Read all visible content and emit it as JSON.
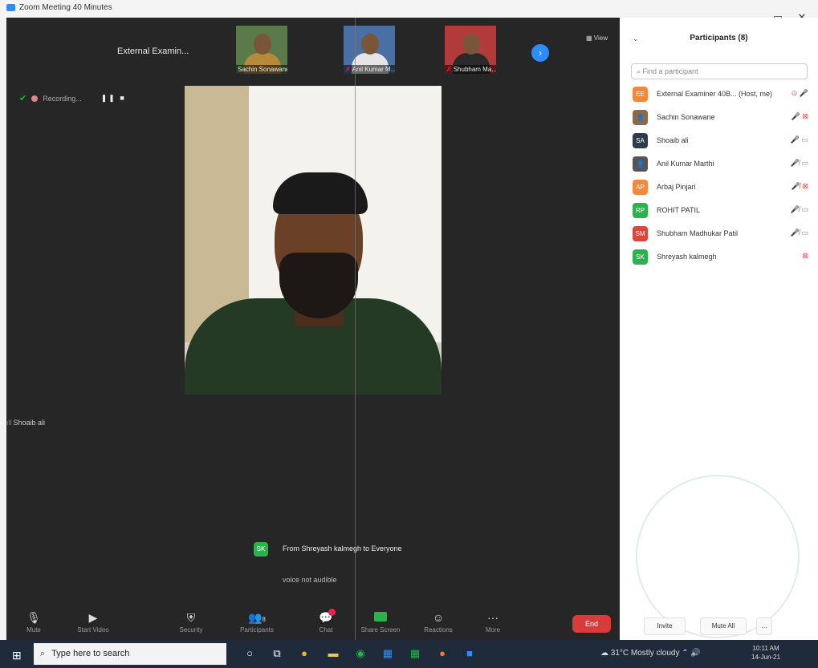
{
  "window": {
    "title": "Zoom Meeting 40 Minutes",
    "minimize": "—",
    "maximize": "▭",
    "close": "✕"
  },
  "meeting": {
    "external_name": "External Examin...",
    "view_label": "▦ View",
    "next_arrow": "›",
    "recording_label": "Recording...",
    "recording_controls": "❚❚ ■",
    "thumbnails": [
      {
        "name": "Sachin Sonawane",
        "mic_muted": false,
        "bg": "#5a7a4a",
        "shirt": "#b58a3a"
      },
      {
        "name": "Anil Kumar M...",
        "mic_muted": true,
        "bg": "#4a6fa5",
        "shirt": "#e5e5e5"
      },
      {
        "name": "Shubham Ma...",
        "mic_muted": true,
        "bg": "#b33a3a",
        "shirt": "#2a2a2a"
      }
    ],
    "speaker_name": "Shoaib ali",
    "chat": {
      "initials": "SK",
      "from": "From Shreyash kalmegh to Everyone",
      "message": "voice not audible"
    }
  },
  "toolbar": {
    "mute": "Mute",
    "start_video": "Start Video",
    "security": "Security",
    "participants": "Participants",
    "participants_count": "8",
    "chat": "Chat",
    "share_screen": "Share Screen",
    "reactions": "Reactions",
    "more": "More",
    "end": "End"
  },
  "panel": {
    "title": "Participants (8)",
    "search_placeholder": "Find a participant",
    "participants": [
      {
        "initials": "EE",
        "name": "External Examiner 40B... (Host, me)",
        "color": "#f0883e",
        "mic": "on",
        "cam": "host"
      },
      {
        "initials": "",
        "name": "Sachin Sonawane",
        "color": "#8a6a4a",
        "mic": "on",
        "cam": "off"
      },
      {
        "initials": "SA",
        "name": "Shoaib ali",
        "color": "#2f3b4a",
        "mic": "on",
        "cam": "on"
      },
      {
        "initials": "",
        "name": "Anil Kumar Marthi",
        "color": "#555555",
        "mic": "off",
        "cam": "on"
      },
      {
        "initials": "AP",
        "name": "Arbaj Pinjari",
        "color": "#f0883e",
        "mic": "off",
        "cam": "off"
      },
      {
        "initials": "RP",
        "name": "ROHIT PATIL",
        "color": "#2bb24c",
        "mic": "off",
        "cam": "on"
      },
      {
        "initials": "SM",
        "name": "Shubham Madhukar Patil",
        "color": "#d9463a",
        "mic": "off",
        "cam": "on"
      },
      {
        "initials": "SK",
        "name": "Shreyash kalmegh",
        "color": "#2bb24c",
        "mic": "none",
        "cam": "off"
      }
    ],
    "invite": "Invite",
    "mute_all": "Mute All",
    "more": "..."
  },
  "taskbar": {
    "search_placeholder": "Type here to search",
    "weather": "31°C Mostly cloudy",
    "time": "10:11 AM",
    "date": "14-Jun-21"
  }
}
